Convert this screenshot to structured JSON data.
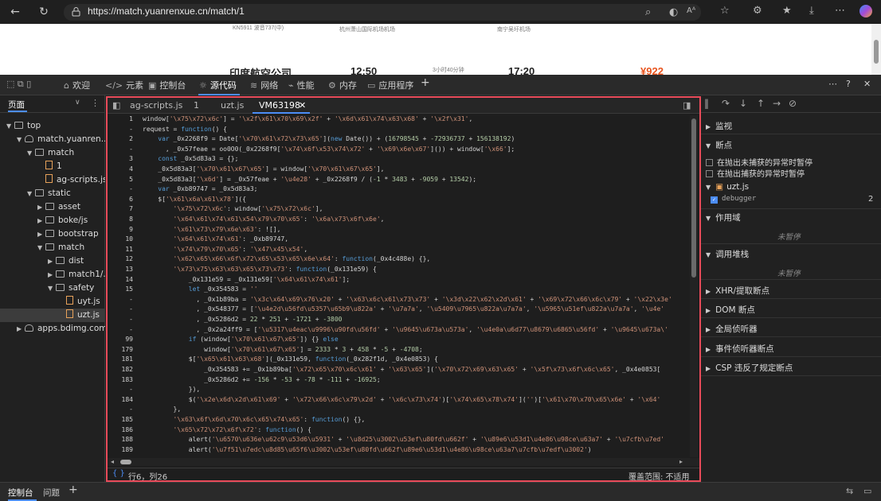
{
  "browser": {
    "url": "https://match.yuanrenxue.cn/match/1",
    "read_aloud": "Aᴬ"
  },
  "page": {
    "flight_no": "KN5911 波音737(中)",
    "depart_airport": "杭州萧山国际机场机场",
    "arrive_airport": "南宁吴圩机场",
    "airline": "印度航空公司",
    "depart_time": "12:50",
    "duration": "3小时40分钟",
    "arrive_time": "17:20",
    "price": "¥922"
  },
  "devtools": {
    "tabs": [
      "欢迎",
      "元素",
      "控制台",
      "源代码",
      "网络",
      "性能",
      "内存",
      "应用程序"
    ],
    "active_tab": "源代码"
  },
  "navigator": {
    "header": "页面",
    "items": [
      {
        "label": "top",
        "depth": 0,
        "kind": "frame",
        "open": true
      },
      {
        "label": "match.yuanren...",
        "depth": 1,
        "kind": "cloud",
        "open": true
      },
      {
        "label": "match",
        "depth": 2,
        "kind": "folder",
        "open": true
      },
      {
        "label": "1",
        "depth": 3,
        "kind": "file",
        "open": false
      },
      {
        "label": "ag-scripts.js",
        "depth": 3,
        "kind": "file",
        "open": false
      },
      {
        "label": "static",
        "depth": 2,
        "kind": "folder",
        "open": true
      },
      {
        "label": "asset",
        "depth": 3,
        "kind": "folder",
        "open": false
      },
      {
        "label": "boke/js",
        "depth": 3,
        "kind": "folder",
        "open": false
      },
      {
        "label": "bootstrap",
        "depth": 3,
        "kind": "folder",
        "open": false
      },
      {
        "label": "match",
        "depth": 3,
        "kind": "folder",
        "open": true
      },
      {
        "label": "dist",
        "depth": 4,
        "kind": "folder",
        "open": false
      },
      {
        "label": "match1/...",
        "depth": 4,
        "kind": "folder",
        "open": false
      },
      {
        "label": "safety",
        "depth": 4,
        "kind": "folder",
        "open": true
      },
      {
        "label": "uyt.js",
        "depth": 5,
        "kind": "file",
        "open": false
      },
      {
        "label": "uzt.js",
        "depth": 5,
        "kind": "file",
        "open": false,
        "selected": true
      },
      {
        "label": "apps.bdimg.com",
        "depth": 1,
        "kind": "cloud",
        "open": false
      }
    ]
  },
  "editor": {
    "tabs": [
      "ag-scripts.js",
      "1",
      "uzt.js",
      "VM63198"
    ],
    "active_tab": "VM63198",
    "line_numbers": [
      "1",
      "-",
      "2",
      "-",
      "3",
      "4",
      "5",
      "-",
      "6",
      "7",
      "8",
      "9",
      "10",
      "11",
      "12",
      "13",
      "14",
      "15",
      "-",
      "-",
      "-",
      "-",
      "99",
      "179",
      "181",
      "182",
      "183",
      "-",
      "184",
      "-",
      "185",
      "186",
      "188",
      "189",
      "-"
    ],
    "lines": [
      "window['\\x75\\x72\\x6c'] = '\\x2f\\x61\\x70\\x69\\x2f' + '\\x6d\\x61\\x74\\x63\\x68' + '\\x2f\\x31',",
      "request = function() {",
      "    var _0x2268f9 = Date['\\x70\\x61\\x72\\x73\\x65'](new Date()) + (16798545 + -72936737 + 156138192)",
      "      , _0x57feae = oo0O0(_0x2268f9['\\x74\\x6f\\x53\\x74\\x72' + '\\x69\\x6e\\x67']()) + window['\\x66'];",
      "    const _0x5d83a3 = {};",
      "    _0x5d83a3['\\x70\\x61\\x67\\x65'] = window['\\x70\\x61\\x67\\x65'],",
      "    _0x5d83a3['\\x6d'] = _0x57feae + '\\u4e28' + _0x2268f9 / (-1 * 3483 + -9059 + 13542);",
      "    var _0xb89747 = _0x5d83a3;",
      "    $['\\x61\\x6a\\x61\\x78']({",
      "        '\\x75\\x72\\x6c': window['\\x75\\x72\\x6c'],",
      "        '\\x64\\x61\\x74\\x61\\x54\\x79\\x70\\x65': '\\x6a\\x73\\x6f\\x6e',",
      "        '\\x61\\x73\\x79\\x6e\\x63': ![],",
      "        '\\x64\\x61\\x74\\x61': _0xb89747,",
      "        '\\x74\\x79\\x70\\x65': '\\x47\\x45\\x54',",
      "        '\\x62\\x65\\x66\\x6f\\x72\\x65\\x53\\x65\\x6e\\x64': function(_0x4c488e) {},",
      "        '\\x73\\x75\\x63\\x63\\x65\\x73\\x73': function(_0x131e59) {",
      "            _0x131e59 = _0x131e59['\\x64\\x61\\x74\\x61'];",
      "            let _0x354583 = ''",
      "              , _0x1b89ba = '\\x3c\\x64\\x69\\x76\\x20' + '\\x63\\x6c\\x61\\x73\\x73' + '\\x3d\\x22\\x62\\x2d\\x61' + '\\x69\\x72\\x66\\x6c\\x79' + '\\x22\\x3e'",
      "              , _0x548377 = ['\\u4e2d\\u56fd\\u5357\\u65b9\\u822a' + '\\u7a7a', '\\u5409\\u7965\\u822a\\u7a7a', '\\u5965\\u51ef\\u822a\\u7a7a', '\\u4e'",
      "              , _0x5286d2 = 22 * 251 + -1721 + -3800",
      "              , _0x2a24ff9 = ['\\u5317\\u4eac\\u9996\\u90fd\\u56fd' + '\\u9645\\u673a\\u573a', '\\u4e0a\\u6d77\\u8679\\u6865\\u56fd' + '\\u9645\\u673a\\'",
      "            if (window['\\x70\\x61\\x67\\x65']) {} else",
      "                window['\\x70\\x61\\x67\\x65'] = 2333 * 3 + 458 * -5 + -4708;",
      "            $['\\x65\\x61\\x63\\x68'](_0x131e59, function(_0x282f1d, _0x4e0853) {",
      "                _0x354583 += _0x1b89ba['\\x72\\x65\\x70\\x6c\\x61' + '\\x63\\x65']('\\x70\\x72\\x69\\x63\\x65' + '\\x5f\\x73\\x6f\\x6c\\x65', _0x4e0853[",
      "                _0x5286d2 += -156 * -53 + -78 * -111 + -16925;",
      "            }),",
      "            $('\\x2e\\x6d\\x2d\\x61\\x69' + '\\x72\\x66\\x6c\\x79\\x2d' + '\\x6c\\x73\\x74')['\\x74\\x65\\x78\\x74']('')['\\x61\\x70\\x70\\x65\\x6e' + '\\x64'",
      "        },",
      "        '\\x63\\x6f\\x6d\\x70\\x6c\\x65\\x74\\x65': function() {},",
      "        '\\x65\\x72\\x72\\x6f\\x72': function() {",
      "            alert('\\u6570\\u636e\\u62c9\\u53d6\\u5931' + '\\u8d25\\u3002\\u53ef\\u80fd\\u662f' + '\\u89e6\\u53d1\\u4e86\\u98ce\\u63a7' + '\\u7cfb\\u7ed'",
      "            alert('\\u7f51\\u7edc\\u8d85\\u65f6\\u3002\\u53ef\\u80fd\\u662f\\u89e6\\u53d1\\u4e86\\u98ce\\u63a7\\u7cfb\\u7edf\\u3002')"
    ],
    "cursor": "行6，列26",
    "coverage": "覆盖范围: 不适用"
  },
  "debugger": {
    "watch": "监视",
    "breakpoints": "断点",
    "pause_uncaught": "在抛出未捕获的异常时暂停",
    "pause_caught": "在抛出捕获的异常时暂停",
    "bp_file": "uzt.js",
    "bp_line_text": "debugger",
    "bp_line_no": "2",
    "scope": "作用域",
    "not_paused_1": "未暂停",
    "call_stack": "调用堆栈",
    "not_paused_2": "未暂停",
    "xhr": "XHR/提取断点",
    "dom": "DOM 断点",
    "global": "全局侦听器",
    "event": "事件侦听器断点",
    "csp": "CSP 违反了规定断点"
  },
  "drawer": {
    "tabs": [
      "控制台",
      "问题"
    ]
  }
}
